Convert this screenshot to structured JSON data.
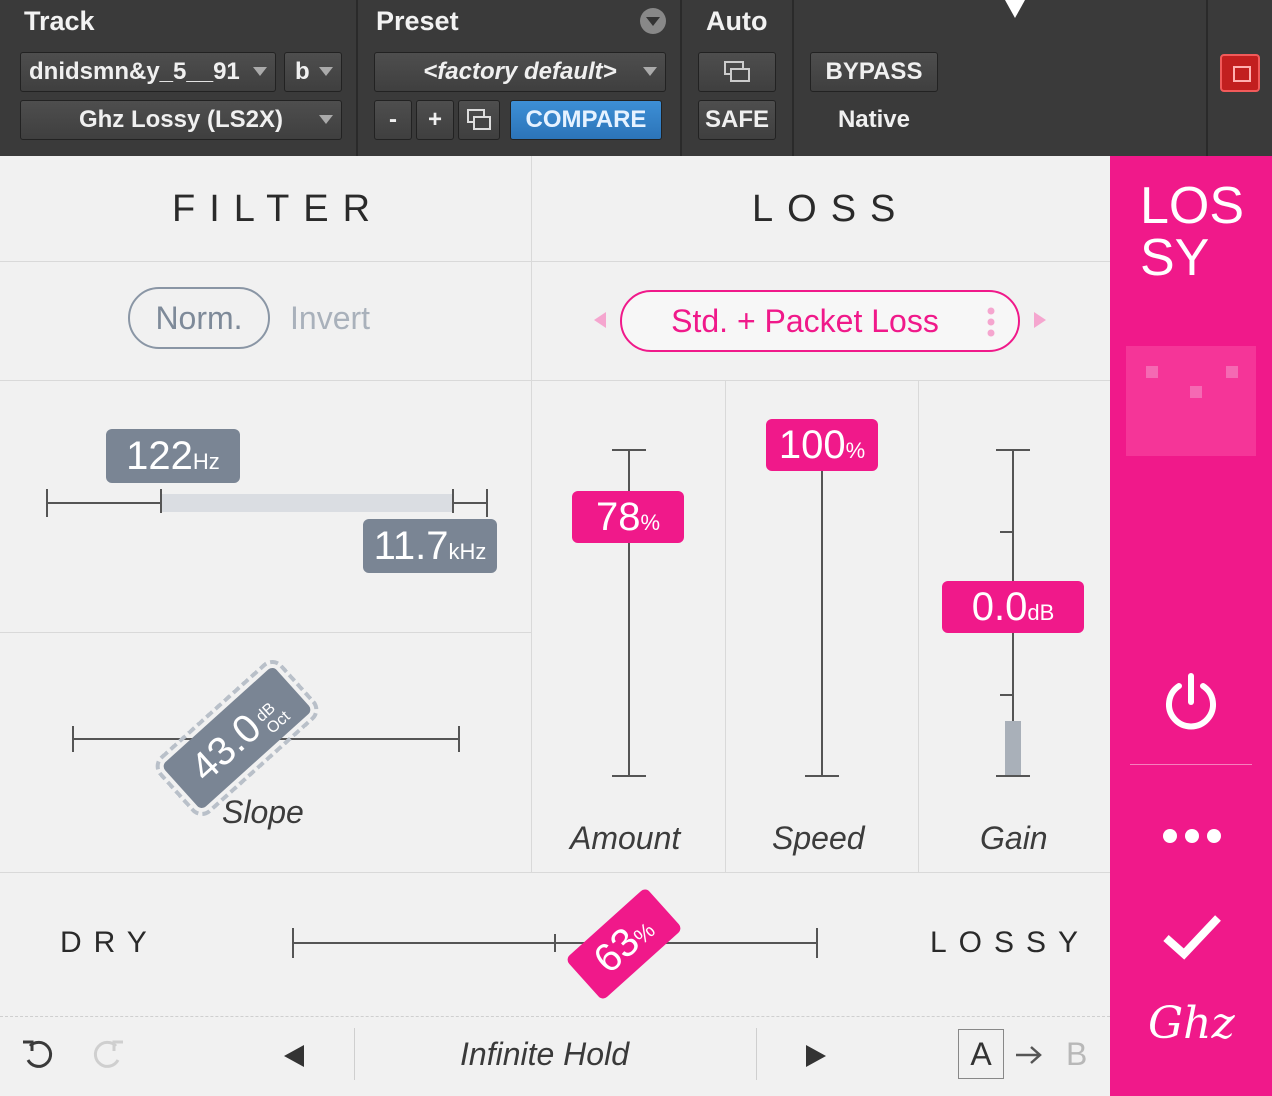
{
  "host": {
    "track_title": "Track",
    "preset_title": "Preset",
    "auto_title": "Auto",
    "track_name": "dnidsmn&y_5__91",
    "track_channel": "b",
    "plugin_name": "Ghz Lossy (LS2X)",
    "preset_name": "<factory default>",
    "minus_label": "-",
    "plus_label": "+",
    "compare_label": "COMPARE",
    "safe_label": "SAFE",
    "bypass_label": "BYPASS",
    "native_label": "Native"
  },
  "filter": {
    "title": "FILTER",
    "mode_norm": "Norm.",
    "mode_invert": "Invert",
    "low_value": "122",
    "low_unit": "Hz",
    "high_value": "11.7",
    "high_unit": "kHz",
    "slope_value": "43.0",
    "slope_unit_top": "dB",
    "slope_unit_bottom": "Oct",
    "slope_label": "Slope"
  },
  "loss": {
    "title": "LOSS",
    "mode": "Std. + Packet Loss",
    "amount_value": "78",
    "amount_unit": "%",
    "amount_label": "Amount",
    "speed_value": "100",
    "speed_unit": "%",
    "speed_label": "Speed",
    "gain_value": "0.0",
    "gain_unit": "dB",
    "gain_label": "Gain"
  },
  "mix": {
    "dry_label": "DRY",
    "wet_label": "LOSSY",
    "value": "63",
    "unit": "%"
  },
  "footer": {
    "preset": "Infinite Hold",
    "a_label": "A",
    "b_label": "B"
  },
  "sidebar": {
    "logo_line1": "LOS",
    "logo_line2": "SY",
    "brand": "Ghz"
  },
  "colors": {
    "accent": "#f0198a",
    "tag_gray": "#7a8594",
    "compare_blue": "#2c74b8"
  }
}
